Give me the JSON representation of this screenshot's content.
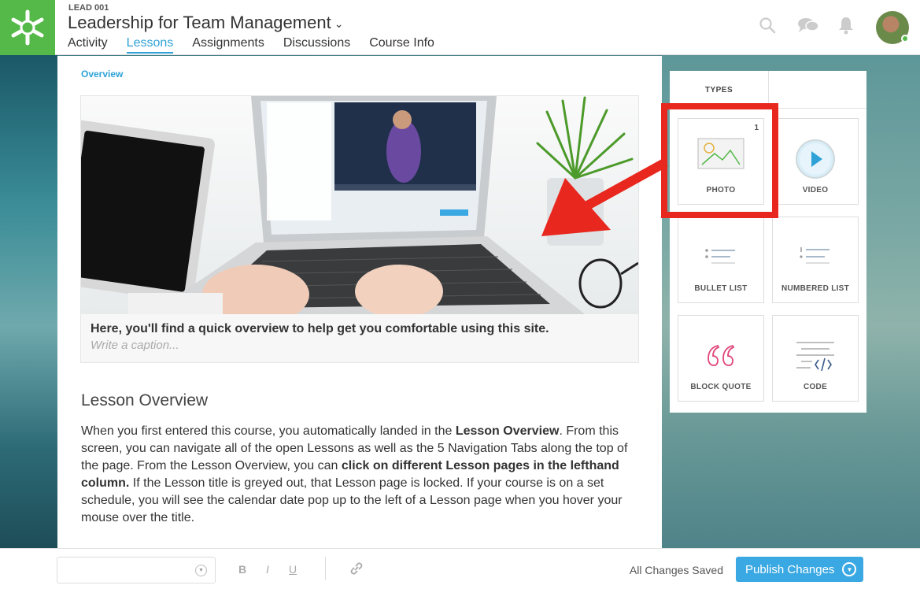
{
  "header": {
    "course_code": "LEAD 001",
    "course_title": "Leadership for Team Management",
    "tabs": [
      {
        "label": "Activity",
        "active": false
      },
      {
        "label": "Lessons",
        "active": true
      },
      {
        "label": "Assignments",
        "active": false
      },
      {
        "label": "Discussions",
        "active": false
      },
      {
        "label": "Course Info",
        "active": false
      }
    ],
    "icons": [
      "search-icon",
      "chat-icon",
      "bell-icon"
    ]
  },
  "breadcrumb": "Overview",
  "figure": {
    "caption": "Here, you'll find a quick overview to help get you comfortable using this site.",
    "caption_placeholder": "Write a caption..."
  },
  "lesson": {
    "heading": "Lesson Overview",
    "p1": "When you first entered this course, you automatically landed in the ",
    "b1": "Lesson Overview",
    "p2": ". From this screen, you can navigate all of the open Lessons as well as the 5 Navigation Tabs along the top of the page. From the Lesson Overview, you can ",
    "b2": "click on different Lesson pages in the lefthand column.",
    "p3": " If the Lesson title is greyed out, that Lesson page is locked. If your course is on a set schedule, you will see the calendar date pop up to the left of a Lesson page when you hover your mouse over the title."
  },
  "types_panel": {
    "tab_label": "TYPES",
    "tiles": [
      {
        "label": "PHOTO",
        "count": "1",
        "icon": "photo-icon"
      },
      {
        "label": "VIDEO",
        "icon": "play-icon"
      },
      {
        "label": "BULLET LIST",
        "icon": "bullet-list-icon"
      },
      {
        "label": "NUMBERED LIST",
        "icon": "numbered-list-icon"
      },
      {
        "label": "BLOCK QUOTE",
        "icon": "quote-icon"
      },
      {
        "label": "CODE",
        "icon": "code-icon"
      }
    ]
  },
  "toolbar": {
    "bold": "B",
    "italic": "I",
    "underline": "U",
    "saved_status": "All Changes Saved",
    "publish_label": "Publish Changes"
  },
  "colors": {
    "brand_green": "#54b948",
    "accent_blue": "#2ea2d6",
    "publish_blue": "#3aa8e2",
    "highlight_red": "#e8271e"
  }
}
